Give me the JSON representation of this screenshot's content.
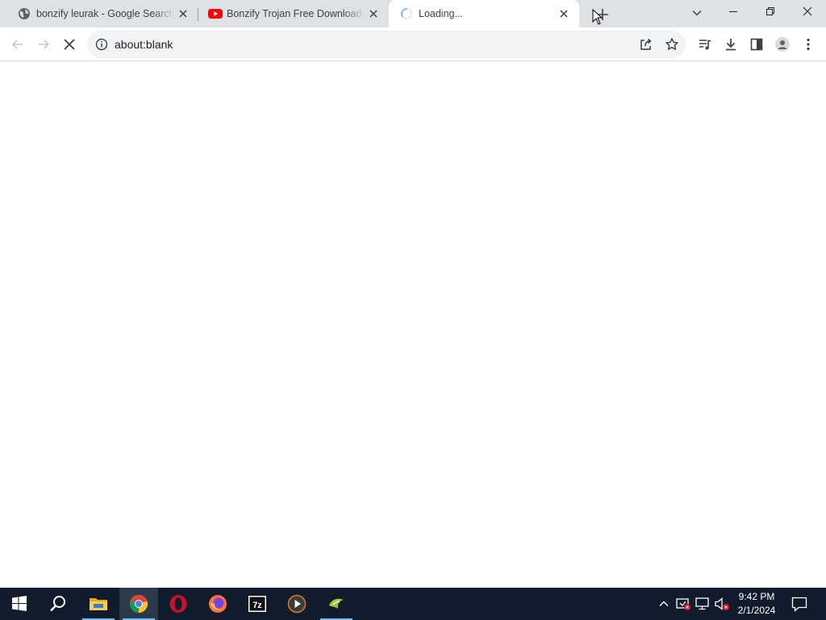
{
  "browser": {
    "tabs": [
      {
        "title": "bonzify leurak - Google Search",
        "favicon": "globe-icon"
      },
      {
        "title": "Bonzify Trojan Free Download Ap",
        "favicon": "youtube-icon"
      },
      {
        "title": "Loading...",
        "favicon": "loading-spinner-icon",
        "active": true
      }
    ],
    "omnibox": {
      "url": "about:blank"
    },
    "colors": {
      "tabstrip": "#dee1e6",
      "omnibox": "#f1f3f4",
      "youtube_red": "#ff0000"
    }
  },
  "taskbar": {
    "apps": [
      {
        "name": "start-button"
      },
      {
        "name": "search-button"
      },
      {
        "name": "file-explorer"
      },
      {
        "name": "google-chrome",
        "active": true
      },
      {
        "name": "opera"
      },
      {
        "name": "firefox"
      },
      {
        "name": "7-zip"
      },
      {
        "name": "media-player"
      },
      {
        "name": "bonzi-app"
      }
    ],
    "clock": {
      "time": "9:42 PM",
      "date": "2/1/2024"
    },
    "colors": {
      "background": "#101c2c",
      "indicator": "#76b9ed"
    }
  }
}
